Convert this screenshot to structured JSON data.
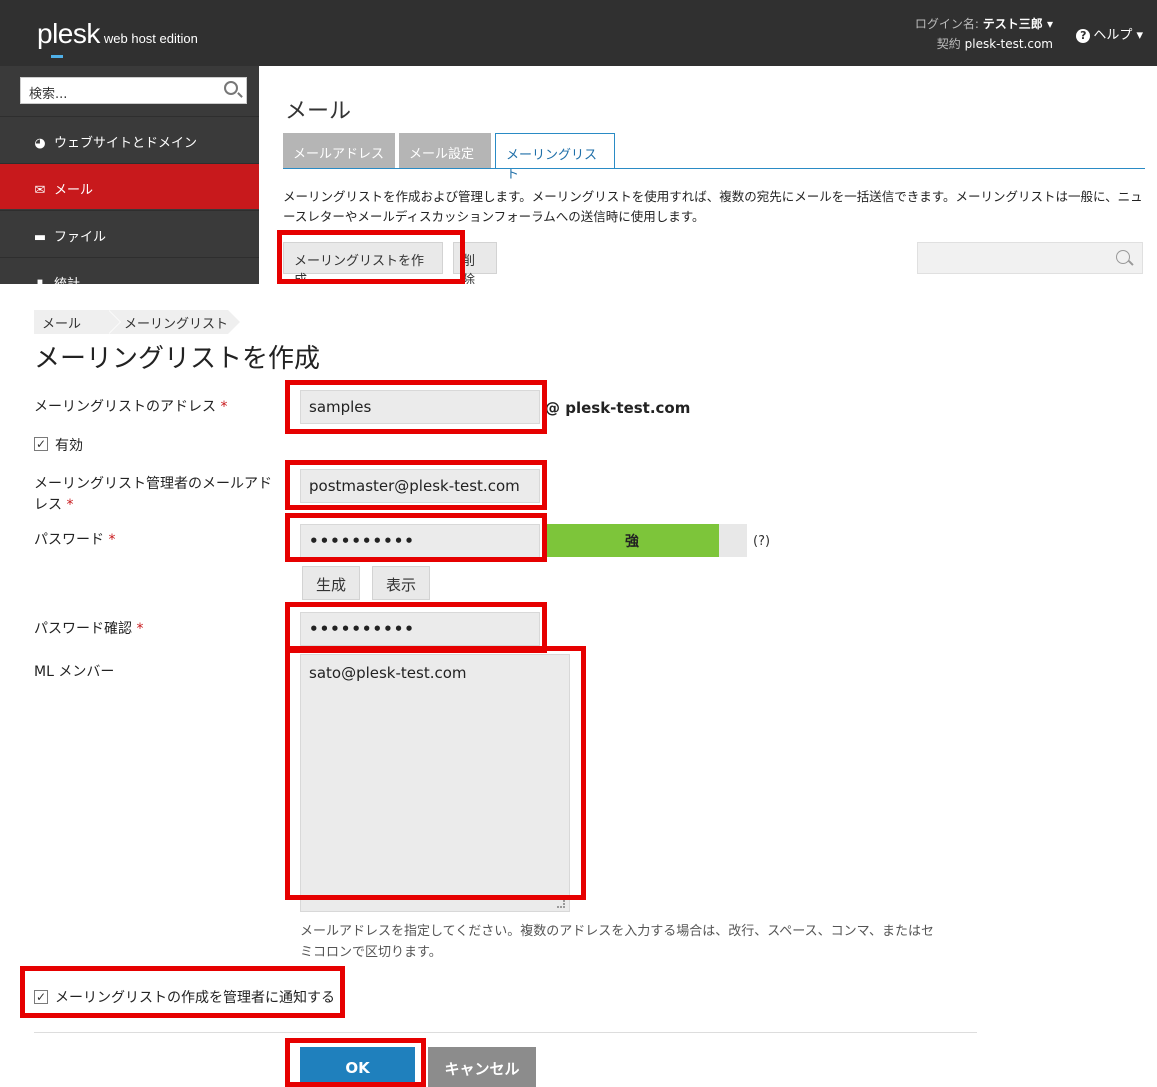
{
  "header": {
    "brand": "plesk",
    "edition": "web host edition",
    "login_label": "ログイン名:",
    "login_user": "テスト三郎 ▾",
    "contract_label": "契約",
    "contract_domain": "plesk-test.com",
    "help_label": "ヘルプ ▾"
  },
  "sidebar": {
    "search_placeholder": "検索...",
    "items": [
      {
        "label": "ウェブサイトとドメイン",
        "icon": "globe-icon"
      },
      {
        "label": "メール",
        "icon": "mail-icon"
      },
      {
        "label": "ファイル",
        "icon": "folder-icon"
      },
      {
        "label": "統計",
        "icon": "bar-chart-icon"
      }
    ]
  },
  "mail_page": {
    "title": "メール",
    "tabs": [
      "メールアドレス",
      "メール設定",
      "メーリングリスト"
    ],
    "active_tab": "メーリングリスト",
    "description": "メーリングリストを作成および管理します。メーリングリストを使用すれば、複数の宛先にメールを一括送信できます。メーリングリストは一般に、ニュースレターやメールディスカッションフォーラムへの送信時に使用します。",
    "create_button": "メーリングリストを作成",
    "delete_button": "削除"
  },
  "breadcrumb": [
    "メール",
    "メーリングリスト"
  ],
  "form": {
    "title": "メーリングリストを作成",
    "address_label": "メーリングリストのアドレス",
    "address_value": "samples",
    "address_domain": "@ plesk-test.com",
    "enabled_label": "有効",
    "admin_email_label_1": "メーリングリスト管理者のメールアド",
    "admin_email_label_2": "レス",
    "admin_email_value": "postmaster@plesk-test.com",
    "password_label": "パスワード",
    "password_value": "••••••••••",
    "strength_label": "強",
    "strength_help": "(?)",
    "generate_button": "生成",
    "show_button": "表示",
    "confirm_label": "パスワード確認",
    "confirm_value": "••••••••••",
    "members_label": "ML メンバー",
    "members_value": "sato@plesk-test.com",
    "hint": "メールアドレスを指定してください。複数のアドレスを入力する場合は、改行、スペース、コンマ、またはセミコロンで区切ります。",
    "notify_label": "メーリングリストの作成を管理者に通知する",
    "required_mark": "*",
    "ok_button": "OK",
    "cancel_button": "キャンセル"
  },
  "colors": {
    "header_bg": "#303030",
    "sidebar_bg": "#3a3a3a",
    "active_nav": "#c8191c",
    "tab_accent": "#2a8bc5",
    "ok_button": "#1f80bd",
    "strength_strong": "#7dc53a",
    "highlight_box": "#e60000"
  }
}
